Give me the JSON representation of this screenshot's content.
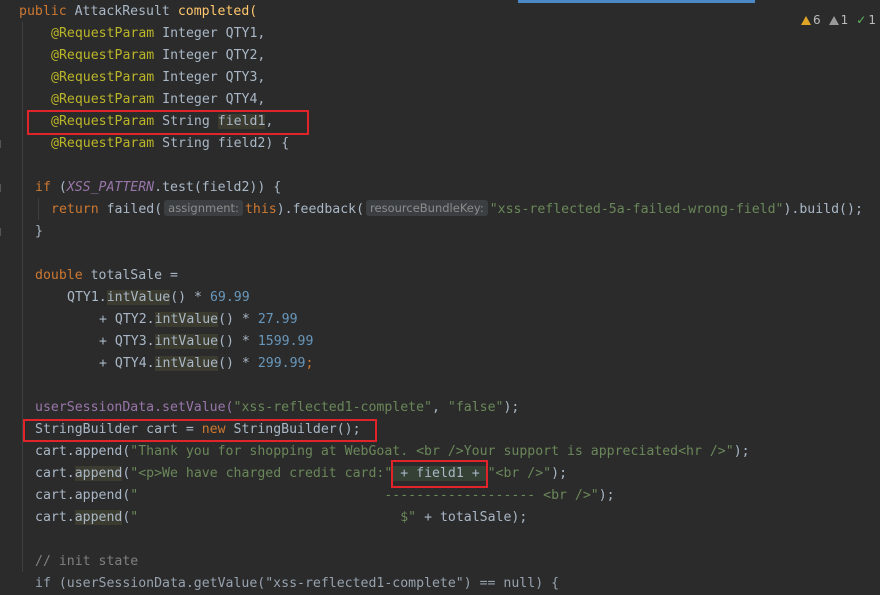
{
  "editor": {
    "lines": {
      "l1": {
        "kw": "public",
        "type": "AttackResult",
        "method": "completed("
      },
      "l2": {
        "ann": "@RequestParam",
        "rest": " Integer QTY1,"
      },
      "l3": {
        "ann": "@RequestParam",
        "rest": " Integer QTY2,"
      },
      "l4": {
        "ann": "@RequestParam",
        "rest": " Integer QTY3,"
      },
      "l5": {
        "ann": "@RequestParam",
        "rest": " Integer QTY4,"
      },
      "l6": {
        "ann": "@RequestParam",
        "rest": " String ",
        "param": "field1",
        "tail": ","
      },
      "l7": {
        "ann": "@RequestParam",
        "rest": " String field2) {"
      },
      "l8": {
        "kw": "if",
        "a": " (",
        "fld": "XSS_PATTERN",
        "b": ".test(field2)) {"
      },
      "l9": {
        "kw": "return",
        "a": " failed(",
        "hint1": "assignment:",
        "kw2": "this",
        "b": ").feedback(",
        "hint2": "resourceBundleKey:",
        "str": "\"xss-reflected-5a-failed-wrong-field\"",
        "c": ").build();"
      },
      "l10": {
        "text": "}"
      },
      "l11": {
        "kw": "double",
        "a": " totalSale ="
      },
      "l12": {
        "a": "QTY1.",
        "m": "intValue",
        "b": "() * ",
        "num": "69.99"
      },
      "l13": {
        "a": "+ QTY2.",
        "m": "intValue",
        "b": "() * ",
        "num": "27.99"
      },
      "l14": {
        "a": "+ QTY3.",
        "m": "intValue",
        "b": "() * ",
        "num": "1599.99"
      },
      "l15": {
        "a": "+ QTY4.",
        "m": "intValue",
        "b": "() * ",
        "num": "299.99",
        "semi": ";"
      },
      "l16": {
        "a": "userSessionData.setValue(",
        "s1": "\"xss-reflected1-complete\"",
        "b": ", ",
        "s2": "\"false\"",
        "c": ");"
      },
      "l17": {
        "a": "StringBuilder cart = ",
        "kw": "new",
        "b": " StringBuilder();"
      },
      "l18": {
        "a": "cart.append(",
        "s": "\"Thank you for shopping at WebGoat. <br />Your support is appreciated<hr />\"",
        "b": ");"
      },
      "l19": {
        "a": "cart.",
        "m": "append",
        "b": "(",
        "s1": "\"<p>We have charged credit card:\"",
        "c": " + field1 + ",
        "s2": "\"<br />\"",
        "d": ");"
      },
      "l20": {
        "a": "cart.append(",
        "s": "\"                               ------------------- <br />\"",
        "b": ");"
      },
      "l21": {
        "a": "cart.",
        "m": "append",
        "b": "(",
        "s": "\"                                 $\"",
        "c": " + totalSale);"
      },
      "l22": {
        "cmt": "// init state"
      },
      "l23": {
        "text": "if (userSessionData.getValue(\"xss-reflected1-complete\") == null) {"
      }
    }
  },
  "inspections": {
    "warnings": "6",
    "weak_warnings": "1",
    "ok": "1"
  },
  "colors": {
    "background": "#2b2b2b",
    "keyword": "#cc7832",
    "annotation": "#bbb529",
    "string": "#6a8759",
    "number": "#6897bb",
    "highlight_box": "#e0242a"
  }
}
